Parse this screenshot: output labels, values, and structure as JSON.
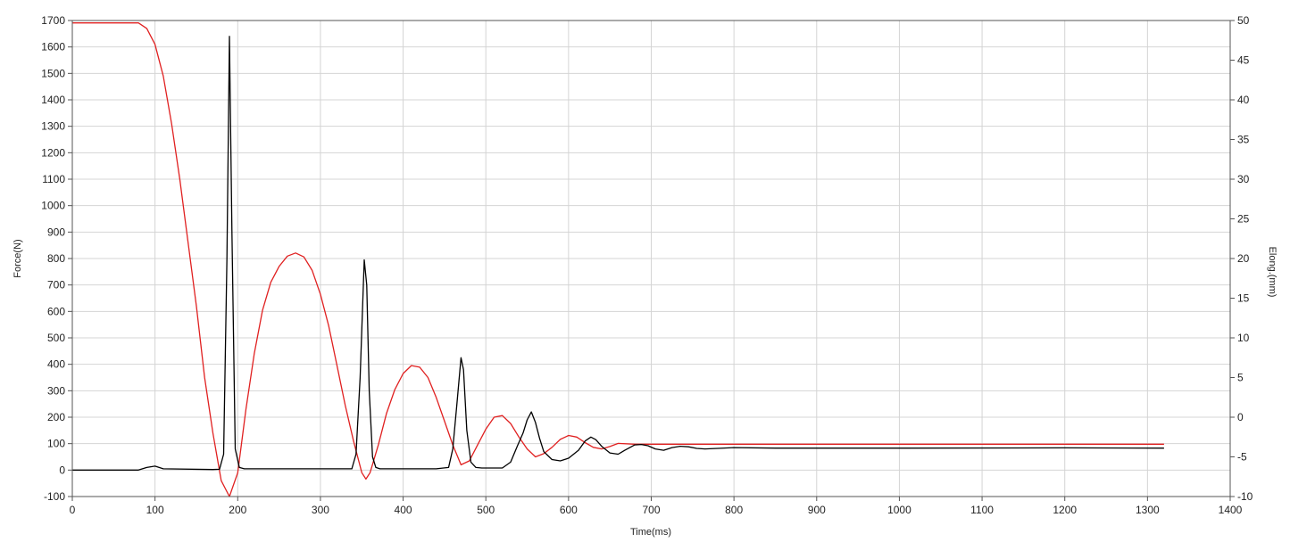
{
  "chart_data": {
    "type": "line",
    "xlabel": "Time(ms)",
    "ylabel_left": "Force(N)",
    "ylabel_right": "Elong.(mm)",
    "xlim": [
      0,
      1400
    ],
    "ylim_left": [
      -100,
      1700
    ],
    "ylim_right": [
      -10,
      50
    ],
    "grid": true,
    "x_ticks": [
      "0",
      "100",
      "200",
      "300",
      "400",
      "500",
      "600",
      "700",
      "800",
      "900",
      "1000",
      "1100",
      "1200",
      "1300",
      "1400"
    ],
    "y_left_ticks": [
      "-100",
      "0",
      "100",
      "200",
      "300",
      "400",
      "500",
      "600",
      "700",
      "800",
      "900",
      "1000",
      "1100",
      "1200",
      "1300",
      "1400",
      "1500",
      "1600",
      "1700"
    ],
    "y_right_ticks": [
      "-10",
      "-5",
      "0",
      "5",
      "10",
      "15",
      "20",
      "25",
      "30",
      "35",
      "40",
      "45",
      "50"
    ],
    "colors": {
      "force": "#000000",
      "elongation": "#e02020",
      "grid": "#d4d4d4",
      "axis": "#555555"
    },
    "series": [
      {
        "axis": "left",
        "color": "#000000",
        "x": [
          0,
          80,
          90,
          100,
          110,
          170,
          178,
          183,
          187,
          190,
          193,
          197,
          202,
          208,
          215,
          260,
          320,
          338,
          343,
          348,
          353,
          356,
          359,
          363,
          367,
          372,
          380,
          440,
          455,
          460,
          465,
          470,
          473,
          477,
          482,
          488,
          495,
          520,
          530,
          538,
          545,
          550,
          555,
          560,
          565,
          570,
          580,
          590,
          600,
          612,
          620,
          627,
          633,
          640,
          650,
          660,
          668,
          680,
          688,
          696,
          705,
          715,
          725,
          735,
          745,
          755,
          765,
          780,
          800,
          850,
          1000,
          1200,
          1320
        ],
        "y": [
          0,
          0,
          10,
          15,
          5,
          2,
          3,
          60,
          800,
          1640,
          900,
          80,
          10,
          5,
          5,
          5,
          5,
          5,
          60,
          350,
          795,
          700,
          300,
          50,
          10,
          5,
          5,
          5,
          10,
          80,
          250,
          425,
          380,
          150,
          30,
          10,
          8,
          8,
          30,
          90,
          140,
          190,
          220,
          180,
          120,
          70,
          40,
          35,
          45,
          75,
          110,
          125,
          115,
          90,
          65,
          60,
          75,
          95,
          97,
          92,
          80,
          75,
          85,
          90,
          88,
          82,
          80,
          82,
          85,
          83,
          83,
          84,
          83
        ]
      },
      {
        "axis": "right",
        "color": "#e02020",
        "x": [
          0,
          80,
          90,
          100,
          110,
          120,
          130,
          140,
          150,
          160,
          170,
          180,
          190,
          200,
          210,
          220,
          230,
          240,
          250,
          260,
          270,
          280,
          290,
          300,
          310,
          320,
          330,
          340,
          350,
          355,
          360,
          370,
          380,
          390,
          400,
          410,
          420,
          430,
          440,
          450,
          460,
          470,
          480,
          490,
          500,
          510,
          520,
          530,
          540,
          550,
          560,
          570,
          580,
          590,
          600,
          610,
          620,
          630,
          640,
          650,
          660,
          680,
          700,
          750,
          800,
          1000,
          1200,
          1320
        ],
        "y": [
          49.7,
          49.7,
          49,
          47,
          43,
          37,
          30,
          22,
          14,
          5,
          -2,
          -8,
          -10,
          -7,
          1,
          8,
          13.5,
          17,
          19,
          20.3,
          20.7,
          20.2,
          18.5,
          15.5,
          11.5,
          6.5,
          1.5,
          -3,
          -7,
          -7.8,
          -7,
          -3.5,
          0.5,
          3.5,
          5.5,
          6.5,
          6.3,
          5,
          2.5,
          -0.5,
          -3.5,
          -6,
          -5.5,
          -3.5,
          -1.5,
          0,
          0.2,
          -0.8,
          -2.5,
          -4,
          -5,
          -4.6,
          -3.8,
          -2.8,
          -2.3,
          -2.5,
          -3.2,
          -3.8,
          -4,
          -3.7,
          -3.3,
          -3.4,
          -3.4,
          -3.4,
          -3.4,
          -3.4,
          -3.4,
          -3.4
        ]
      }
    ]
  }
}
